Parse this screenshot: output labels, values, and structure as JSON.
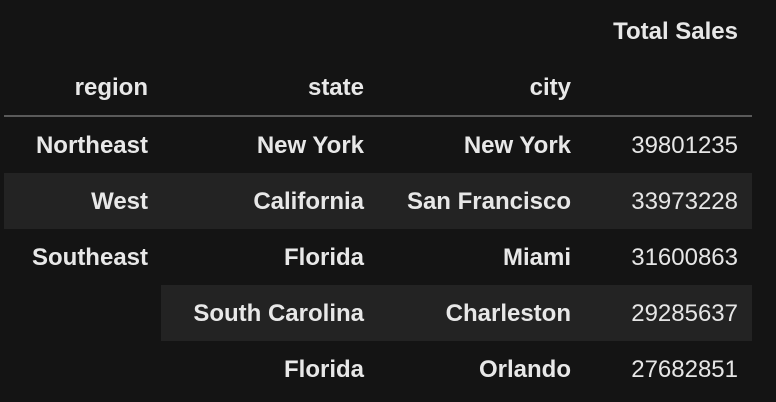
{
  "table": {
    "column_header": "Total Sales",
    "index_names": [
      "region",
      "state",
      "city"
    ],
    "rows": [
      {
        "region": "Northeast",
        "state": "New York",
        "city": "New York",
        "value": "39801235"
      },
      {
        "region": "West",
        "state": "California",
        "city": "San Francisco",
        "value": "33973228"
      },
      {
        "region": "Southeast",
        "state": "Florida",
        "city": "Miami",
        "value": "31600863"
      },
      {
        "region": "",
        "state": "South Carolina",
        "city": "Charleston",
        "value": "29285637"
      },
      {
        "region": "",
        "state": "Florida",
        "city": "Orlando",
        "value": "27682851"
      }
    ]
  },
  "colors": {
    "background": "#141414",
    "stripe": "#232323",
    "text": "#e6e6e6",
    "rule": "#5a5a5a"
  }
}
